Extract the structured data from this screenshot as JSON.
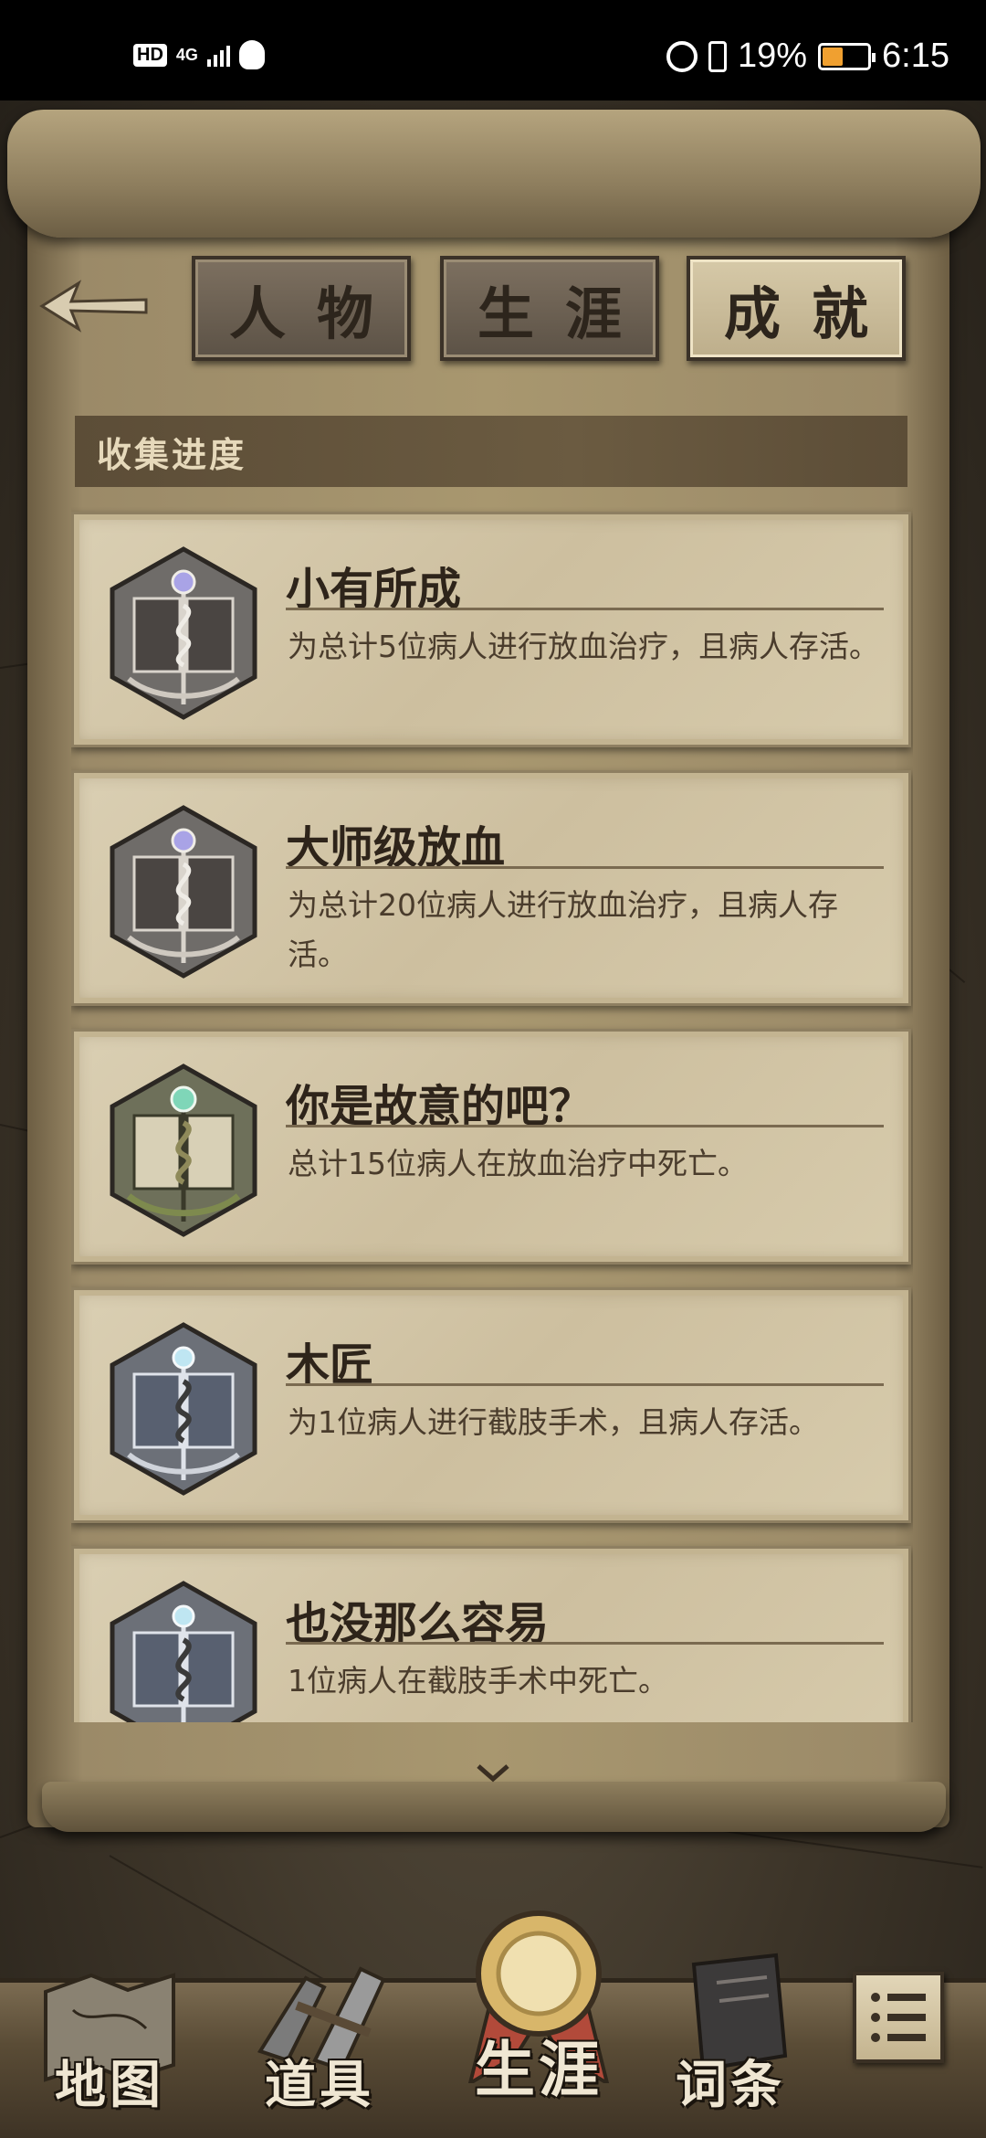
{
  "status_bar": {
    "hd": "HD",
    "network": "4G",
    "battery_percent": "19%",
    "time": "6:15",
    "icons": [
      "signal-icon",
      "qq-icon",
      "alarm-icon",
      "vibrate-icon",
      "battery-icon"
    ]
  },
  "tabs": [
    {
      "label": "人物",
      "active": false
    },
    {
      "label": "生涯",
      "active": false
    },
    {
      "label": "成就",
      "active": true
    }
  ],
  "section": {
    "title": "收集进度"
  },
  "achievements": [
    {
      "title": "小有所成",
      "description": "为总计5位病人进行放血治疗，且病人存活。",
      "badge": "bloodletting-badge-silver"
    },
    {
      "title": "大师级放血",
      "description": "为总计20位病人进行放血治疗，且病人存活。",
      "badge": "bloodletting-badge-silver"
    },
    {
      "title": "你是故意的吧？",
      "description": "总计15位病人在放血治疗中死亡。",
      "badge": "bloodletting-badge-green"
    },
    {
      "title": "木匠",
      "description": "为1位病人进行截肢手术，且病人存活。",
      "badge": "amputation-badge-silver"
    },
    {
      "title": "也没那么容易",
      "description": "1位病人在截肢手术中死亡。",
      "badge": "amputation-badge-silver"
    }
  ],
  "bottom_nav": [
    {
      "label": "地图",
      "icon": "map-icon",
      "active": false
    },
    {
      "label": "道具",
      "icon": "tools-icon",
      "active": false
    },
    {
      "label": "生涯",
      "icon": "medal-icon",
      "active": true
    },
    {
      "label": "词条",
      "icon": "book-icon",
      "active": false
    }
  ],
  "colors": {
    "parchment": "#cdbf9f",
    "ink": "#2e241a",
    "scroll_dark": "#5c4d37",
    "badge_gem_purple": "#a9a3e6",
    "badge_gem_green": "#7fd6b8"
  }
}
